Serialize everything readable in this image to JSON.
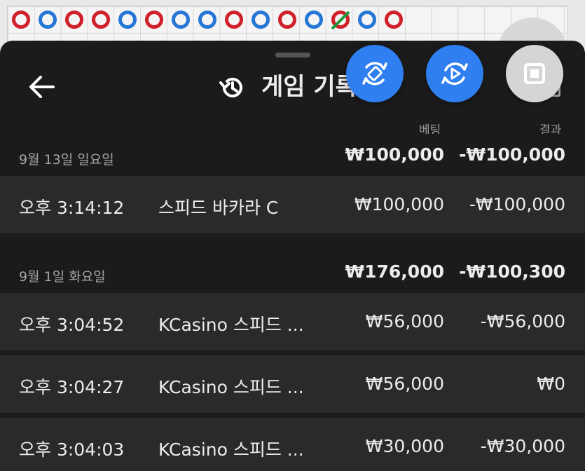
{
  "header": {
    "title": "게임 기록",
    "back_icon": "arrow-left-icon",
    "history_icon": "history-icon"
  },
  "columns": {
    "bet": "베팅",
    "result": "결과"
  },
  "groups": [
    {
      "date": "9월 13일 일요일",
      "bet_total": "₩100,000",
      "result_total": "-₩100,000",
      "rows": [
        {
          "time": "오후 3:14:12",
          "game": "스피드 바카라 C",
          "bet": "₩100,000",
          "result": "-₩100,000"
        }
      ]
    },
    {
      "date": "9월 1일 화요일",
      "bet_total": "₩176,000",
      "result_total": "-₩100,300",
      "rows": [
        {
          "time": "오후 3:04:52",
          "game": "KCasino 스피드 ...",
          "bet": "₩56,000",
          "result": "-₩56,000"
        },
        {
          "time": "오후 3:04:27",
          "game": "KCasino 스피드 ...",
          "bet": "₩56,000",
          "result": "₩0"
        },
        {
          "time": "오후 3:04:03",
          "game": "KCasino 스피드 ...",
          "bet": "₩30,000",
          "result": "-₩30,000"
        }
      ]
    }
  ],
  "floating_buttons": [
    {
      "icon": "rotate-device-icon",
      "color": "#2f7ff0"
    },
    {
      "icon": "replay-icon",
      "color": "#2f7ff0"
    },
    {
      "icon": "stop-icon",
      "color": "#d5d5d5"
    }
  ],
  "colors": {
    "sheet": "#1b1b1b",
    "row": "#2a2a2a",
    "accent": "#2f7ff0",
    "bead_red": "#d0202a",
    "bead_blue": "#2676d6"
  }
}
